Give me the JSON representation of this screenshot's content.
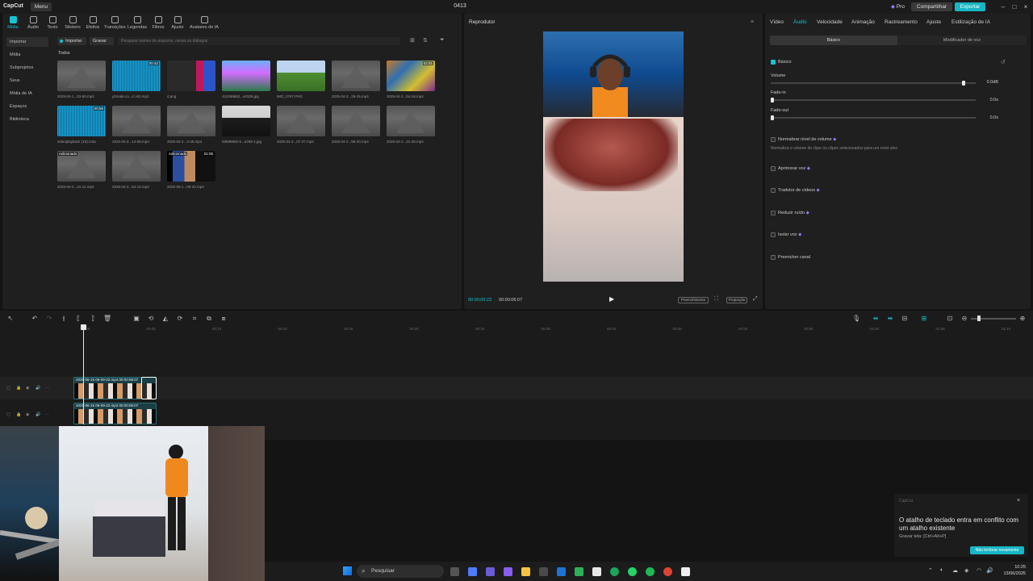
{
  "titlebar": {
    "app_name": "CapCut",
    "menu_label": "Menu",
    "project_title": "0413",
    "pro_label": "Pro",
    "share_label": "Compartilhar",
    "export_label": "Exportar"
  },
  "toolbar": [
    {
      "label": "Mídia",
      "icon": "media-icon"
    },
    {
      "label": "Áudio",
      "icon": "audio-icon"
    },
    {
      "label": "Texto",
      "icon": "text-icon"
    },
    {
      "label": "Stickers",
      "icon": "sticker-icon"
    },
    {
      "label": "Efeitos",
      "icon": "effects-icon"
    },
    {
      "label": "Transições",
      "icon": "transitions-icon"
    },
    {
      "label": "Legendas",
      "icon": "captions-icon"
    },
    {
      "label": "Filtros",
      "icon": "filters-icon"
    },
    {
      "label": "Ajuste",
      "icon": "adjust-icon"
    },
    {
      "label": "Avatares de IA",
      "icon": "avatar-icon"
    }
  ],
  "sidebar": [
    "Importar",
    "Mídia",
    "Subprojetos",
    "Seus",
    "Mídia de IA",
    "Espaços",
    "Biblioteca"
  ],
  "media": {
    "import_label": "Importar",
    "record_label": "Gravar",
    "search_placeholder": "Pesquise nomes de arquivos, cenas ou diálogos",
    "all_label": "Todos",
    "items": [
      {
        "name": "2025-04-1...03-50.mp4",
        "duration": "",
        "badge": ""
      },
      {
        "name": "y2mate.co...ic HD.mp3",
        "duration": "00:42",
        "badge": ""
      },
      {
        "name": "d.png",
        "duration": "",
        "badge": ""
      },
      {
        "name": "cb1069892...e0328.jpg",
        "duration": "",
        "badge": ""
      },
      {
        "name": "IMG_0767.PNG",
        "duration": "",
        "badge": ""
      },
      {
        "name": "2025-04-2...29-15.mp4",
        "duration": "",
        "badge": ""
      },
      {
        "name": "2025-04-2...54-18.mp4",
        "duration": "02:01",
        "badge": ""
      },
      {
        "name": "videoplayback (16).m4a",
        "duration": "00:56",
        "badge": ""
      },
      {
        "name": "2025-04-2...14-55.mp4",
        "duration": "",
        "badge": ""
      },
      {
        "name": "2025-04-2...3-45.mp4",
        "duration": "",
        "badge": ""
      },
      {
        "name": "0d588800-5...a768-1.jpg",
        "duration": "",
        "badge": ""
      },
      {
        "name": "2025-04-2...07-47.mp4",
        "duration": "",
        "badge": ""
      },
      {
        "name": "2025-04-2...59-40.mp4",
        "duration": "",
        "badge": ""
      },
      {
        "name": "2025-04-2...31-45.mp4",
        "duration": "",
        "badge": ""
      },
      {
        "name": "2025-04-2...41-11.mp4",
        "duration": "",
        "badge": "Adicionado"
      },
      {
        "name": "2025-04-2...54-12.mp4",
        "duration": "",
        "badge": ""
      },
      {
        "name": "2025-06-1...09-22.mp4",
        "duration": "01:05",
        "badge": "Adicionado"
      }
    ]
  },
  "player": {
    "title": "Reprodutor",
    "current_time": "00:00:00:23",
    "total_time": "00:00:06:07",
    "fill_label": "Preenchimento",
    "ratio_label": "Proporção"
  },
  "props": {
    "tabs": [
      "Vídeo",
      "Áudio",
      "Velocidade",
      "Animação",
      "Rastreamento",
      "Ajuste",
      "Estilização de IA"
    ],
    "subtabs": [
      "Básico",
      "Modificador de voz"
    ],
    "basic_label": "Básico",
    "volume_label": "Volume",
    "volume_value": "0.0dB",
    "volume_level": 0.94,
    "fadein_label": "Fade-in",
    "fadein_value": "0.0s",
    "fadeout_label": "Fade-out",
    "fadeout_value": "0.0s",
    "normalize_label": "Normalizar nível de volume",
    "normalize_desc": "Normaliza o volume do clipe ou clipes selecionados para um nível-alvo",
    "features": [
      "Aprimorar voz",
      "Tradutor de vídeos",
      "Reduzir ruído",
      "Isolar voz",
      "Preencher canal"
    ]
  },
  "timeline": {
    "ticks": [
      "00:00",
      "00:05",
      "00:10",
      "00:15",
      "00:20",
      "00:25",
      "00:30",
      "00:35",
      "00:40",
      "00:45",
      "00:50",
      "00:55",
      "01:00",
      "01:05",
      "01:10"
    ],
    "clip1_label": "2025-06-15 06-09-22.mp4  00:00:06:07",
    "clip2_label": "2025-06-15 06-09-22.mp4  00:00:06:07"
  },
  "taskbar": {
    "search_label": "Pesquisar",
    "time": "10:25",
    "date": "13/06/2025"
  },
  "toast": {
    "app": "CapCut",
    "title": "O atalho de teclado entra em conflito com um atalho existente",
    "body": "Gravar tela: [Ctrl+Alt+P]",
    "button": "Não lembrar novamente"
  },
  "colors": {
    "accent": "#18c3d1",
    "background": "#141414",
    "panel": "#1f1f1f"
  }
}
